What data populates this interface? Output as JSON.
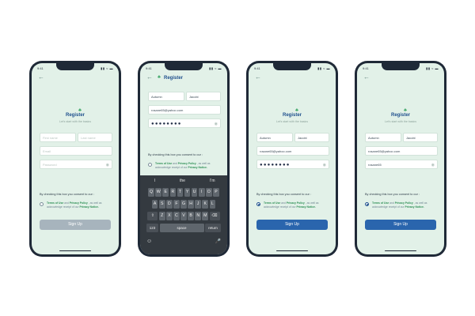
{
  "status": {
    "time": "9:41",
    "icons": "▮▮ ≈ ▬"
  },
  "back_glyph": "←",
  "leaf_glyph": "♣",
  "title": "Register",
  "subtitle": "Let's start with the basics",
  "placeholders": {
    "first_name": "First name",
    "last_name": "Last name",
    "email": "Email",
    "password": "Password"
  },
  "values": {
    "first_name": "Autumn",
    "last_name": "Jacobi",
    "email": "rosane65@yahoo.com",
    "password_masked": "●●●●●●●●",
    "password_plain": "rosane65"
  },
  "eye_glyph": "◉",
  "consent_text": "By checking this box you consent to our :",
  "terms": {
    "prefix": "Terms of Use",
    "and": " and ",
    "policy": "Privacy Policy",
    "rest": " , as well as acknowledge receipt of our ",
    "notice": "Privacy Notice."
  },
  "signup_label": "Sign Up",
  "keyboard": {
    "suggestions": [
      "I",
      "the",
      "I'm"
    ],
    "row1": [
      "Q",
      "W",
      "E",
      "R",
      "T",
      "Y",
      "U",
      "I",
      "O",
      "P"
    ],
    "row2": [
      "A",
      "S",
      "D",
      "F",
      "G",
      "H",
      "J",
      "K",
      "L"
    ],
    "row3": [
      "Z",
      "X",
      "C",
      "V",
      "B",
      "N",
      "M"
    ],
    "shift": "⇧",
    "backspace": "⌫",
    "num": "123",
    "space": "space",
    "return": "return",
    "emoji": "☺",
    "mic": "🎤"
  },
  "colors": {
    "screen_bg": "#e2f1e8",
    "accent_blue": "#2a65ad",
    "accent_green": "#2e8f55",
    "disabled": "#a7b4bd"
  }
}
